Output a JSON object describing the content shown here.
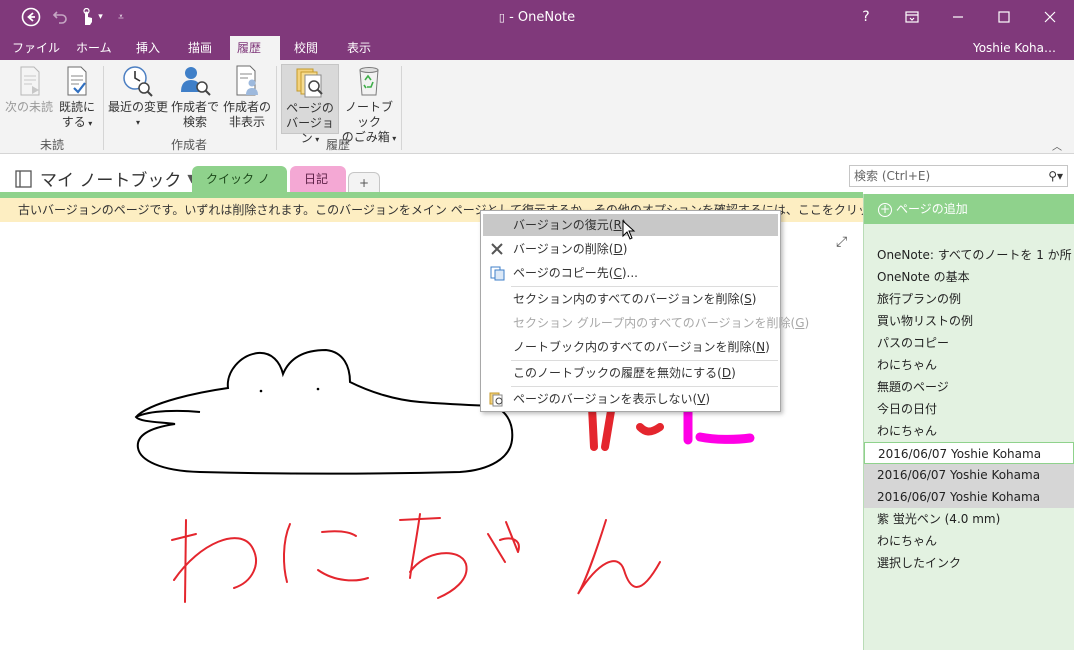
{
  "window": {
    "title": "- OneNote"
  },
  "ribbon_tabs": [
    "ファイル",
    "ホーム",
    "挿入",
    "描画",
    "履歴",
    "校閲",
    "表示"
  ],
  "active_tab": "履歴",
  "user_name": "Yoshie Koha…",
  "ribbon": {
    "next_unread": "次の未読",
    "mark_read_1": "既読に",
    "mark_read_2": "する",
    "recent_changes": "最近の変更",
    "find_author_1": "作成者で",
    "find_author_2": "検索",
    "hide_author_1": "作成者の",
    "hide_author_2": "非表示",
    "page_versions_1": "ページの",
    "page_versions_2": "バージョン",
    "recycle_1": "ノートブック",
    "recycle_2": "のごみ箱",
    "group_unread": "未読",
    "group_author": "作成者",
    "group_history": "履歴"
  },
  "notebook": {
    "name": "マイ ノートブック",
    "sections": [
      {
        "label": "クイック ノート",
        "color": "#8fd28c"
      },
      {
        "label": "日記",
        "color": "#f4a8d4"
      }
    ],
    "add_section": "+"
  },
  "search": {
    "placeholder": "検索 (Ctrl+E)"
  },
  "banner": {
    "text": "古いバージョンのページです。いずれは削除されます。このバージョンをメイン ページとして復元するか、その他のオプションを確認するには、ここをクリックしてください。"
  },
  "page_list": {
    "add_page": "ページの追加",
    "pages": [
      "OneNote: すべてのノートを 1 か所",
      "OneNote の基本",
      "旅行プランの例",
      "買い物リストの例",
      "パスのコピー",
      "わにちゃん",
      "無題のページ",
      "今日の日付",
      "わにちゃん",
      "2016/06/07 Yoshie Kohama",
      "2016/06/07 Yoshie Kohama",
      "2016/06/07 Yoshie Kohama",
      "紫 蛍光ペン (4.0 mm)",
      "わにちゃん",
      "選択したインク"
    ]
  },
  "context_menu": {
    "restore": {
      "text": "バージョンの復元(",
      "key": "R"
    },
    "delete": {
      "text": "バージョンの削除(",
      "key": "D"
    },
    "copy_to": {
      "text": "ページのコピー先(",
      "key": "C",
      "suffix": ")..."
    },
    "delete_section": {
      "text": "セクション内のすべてのバージョンを削除(",
      "key": "S"
    },
    "delete_group": {
      "text": "セクション グループ内のすべてのバージョンを削除(",
      "key": "G"
    },
    "delete_notebook": {
      "text": "ノートブック内のすべてのバージョンを削除(",
      "key": "N"
    },
    "disable_history": {
      "text": "このノートブックの履歴を無効にする(",
      "key": "D"
    },
    "hide_versions": {
      "text": "ページのバージョンを表示しない(",
      "key": "V"
    }
  },
  "colors": {
    "brand": "#80397b",
    "green": "#8fd28c",
    "pink": "#f4a8d4",
    "banner": "#fdeec2"
  }
}
